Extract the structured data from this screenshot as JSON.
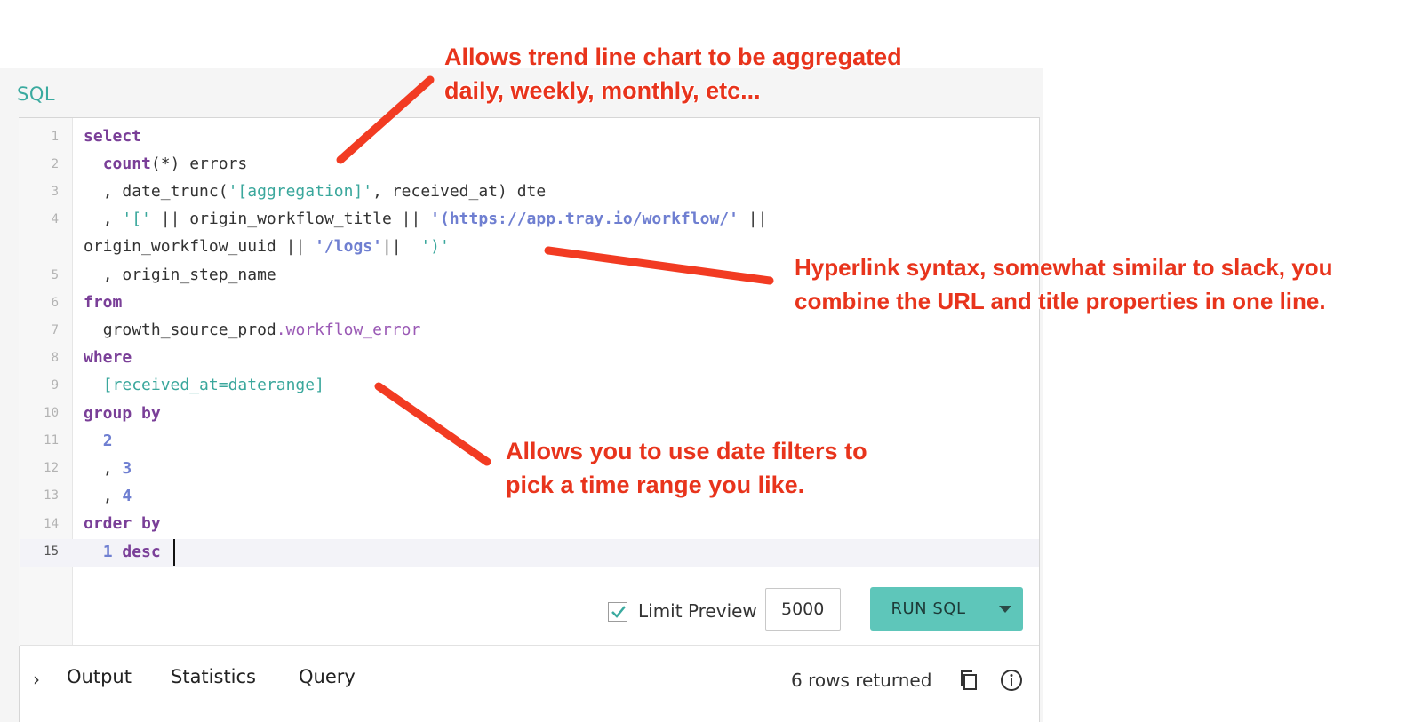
{
  "editor": {
    "title": "SQL",
    "line_numbers": [
      "1",
      "2",
      "3",
      "4",
      "",
      "5",
      "6",
      "7",
      "8",
      "9",
      "10",
      "11",
      "12",
      "13",
      "14",
      "15"
    ]
  },
  "code": {
    "l1_kw": "select",
    "l2_kw": "count",
    "l2_rest": "(*) errors",
    "l3_pre": ", date_trunc(",
    "l3_str": "'[aggregation]'",
    "l3_post": ", received_at) dte",
    "l4_pre": ", ",
    "l4_str1": "'['",
    "l4_mid": " || origin_workflow_title || ",
    "l4_url": "'(https://app.tray.io/workflow/'",
    "l4_post": " ||",
    "l4b_pre": "origin_workflow_uuid || ",
    "l4b_str1": "'/logs'",
    "l4b_mid": "||  ",
    "l4b_str2": "')'",
    "l5": ", origin_step_name",
    "l6_kw": "from",
    "l7_schema": "growth_source_prod",
    "l7_table": ".workflow_error",
    "l8_kw": "where",
    "l9_str": "[received_at=daterange]",
    "l10_kw": "group by",
    "l11_num": "2",
    "l12_pre": ", ",
    "l12_num": "3",
    "l13_pre": ", ",
    "l13_num": "4",
    "l14_kw": "order by",
    "l15_num": "1",
    "l15_kw": "desc"
  },
  "toolbar": {
    "limit_label": "Limit Preview",
    "limit_checked": true,
    "limit_value": "5000",
    "run_label": "RUN SQL"
  },
  "results": {
    "tabs": [
      "Output",
      "Statistics",
      "Query"
    ],
    "rows_returned": "6 rows returned"
  },
  "annotations": {
    "a1_line1": "Allows trend line chart to be aggregated",
    "a1_line2": "daily, weekly, monthly, etc...",
    "a2_line1": "Hyperlink syntax, somewhat similar to slack, you",
    "a2_line2": "combine the URL and title properties in one line.",
    "a3_line1": "Allows you to use date filters to",
    "a3_line2": "pick a time range you like."
  },
  "colors": {
    "accent": "#5ec6ba",
    "keyword": "#7a3f98",
    "string": "#3aa79c",
    "number": "#6f7fd1",
    "annotation": "#e8341c"
  },
  "icons": [
    "chevron-right-icon",
    "copy-icon",
    "info-icon",
    "check-icon",
    "caret-down-icon"
  ]
}
